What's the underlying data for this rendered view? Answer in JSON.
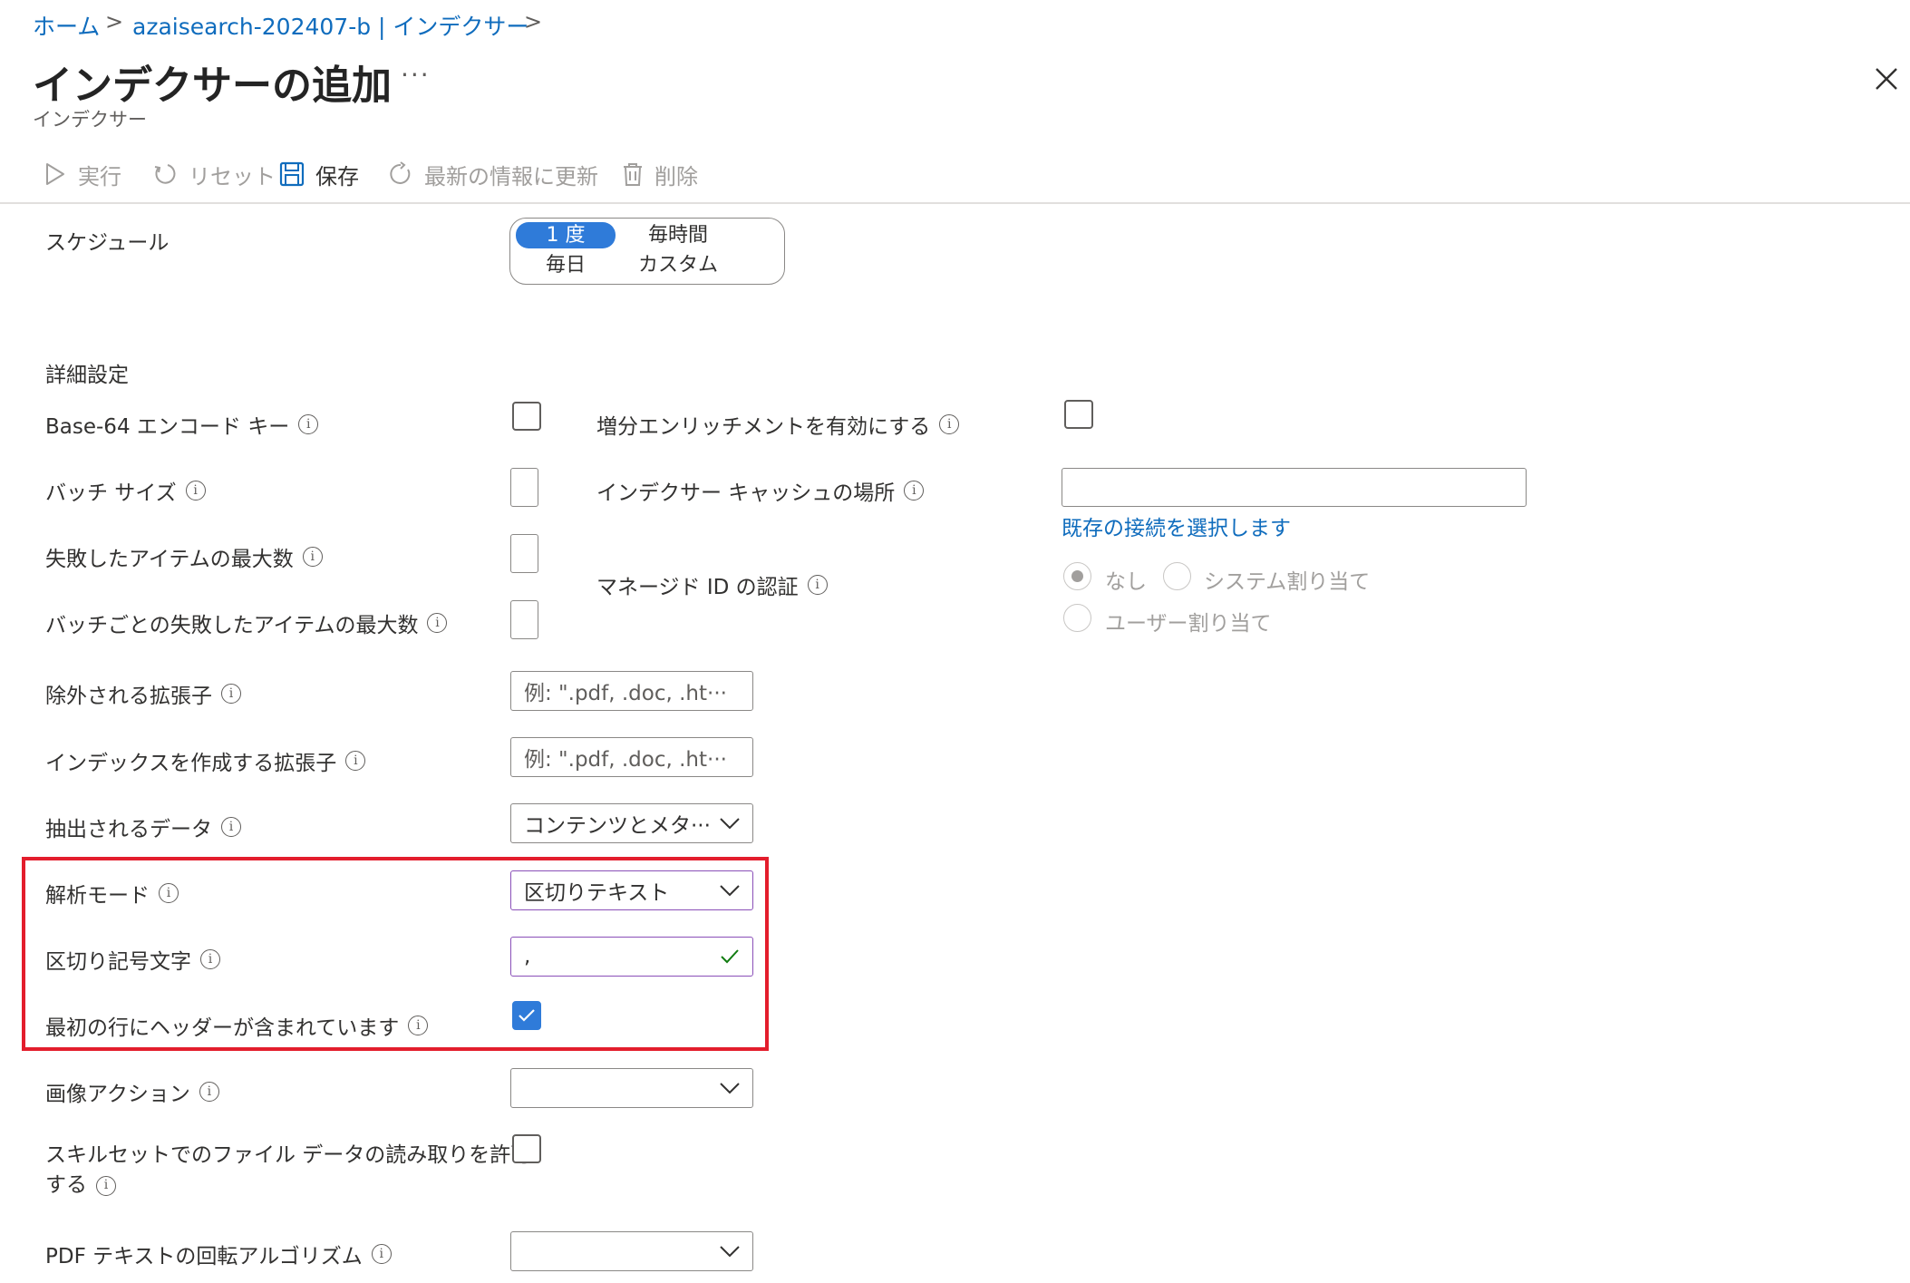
{
  "breadcrumb": {
    "home": "ホーム",
    "resource": "azaisearch-202407-b | インデクサー"
  },
  "page": {
    "title": "インデクサーの追加",
    "more": "···",
    "subtitle": "インデクサー"
  },
  "toolbar": {
    "run": "実行",
    "reset": "リセット",
    "save": "保存",
    "refresh": "最新の情報に更新",
    "delete": "削除"
  },
  "schedule": {
    "label": "スケジュール",
    "options": [
      "1 度",
      "毎時間",
      "毎日",
      "カスタム"
    ],
    "selected": "1 度"
  },
  "advanced": {
    "heading": "詳細設定",
    "base64_label": "Base-64 エンコード キー",
    "batch_size_label": "バッチ サイズ",
    "max_failed_label": "失敗したアイテムの最大数",
    "max_failed_per_batch_label": "バッチごとの失敗したアイテムの最大数",
    "excluded_ext_label": "除外される拡張子",
    "excluded_ext_placeholder": "例: \".pdf, .doc, .ht···",
    "indexed_ext_label": "インデックスを作成する拡張子",
    "indexed_ext_placeholder": "例: \".pdf, .doc, .ht···",
    "data_to_extract_label": "抽出されるデータ",
    "data_to_extract_value": "コンテンツとメタ···",
    "parsing_mode_label": "解析モード",
    "parsing_mode_value": "区切りテキスト",
    "delimiter_label": "区切り記号文字",
    "delimiter_value": ",",
    "first_line_header_label": "最初の行にヘッダーが含まれています",
    "first_line_header_checked": true,
    "image_action_label": "画像アクション",
    "image_action_value": "",
    "skillset_file_label_line1": "スキルセットでのファイル データの読み取りを許可",
    "skillset_file_label_line2": "する",
    "pdf_rotation_label": "PDF テキストの回転アルゴリズム",
    "pdf_rotation_value": ""
  },
  "enrichment": {
    "incremental_label": "増分エンリッチメントを有効にする",
    "cache_location_label": "インデクサー キャッシュの場所",
    "cache_location_value": "",
    "select_connection_link": "既存の接続を選択します",
    "managed_id_label": "マネージド ID の認証",
    "managed_id_options": [
      "なし",
      "システム割り当て",
      "ユーザー割り当て"
    ],
    "managed_id_selected": "なし"
  },
  "icons": {
    "info": "info-icon",
    "close": "close-icon",
    "chevron": "chevron-down-icon",
    "check": "check-icon"
  },
  "colors": {
    "accent": "#2f7bd9",
    "link": "#0f6cbd",
    "highlight_border": "#e31d2c",
    "valid_check": "#107c10"
  }
}
